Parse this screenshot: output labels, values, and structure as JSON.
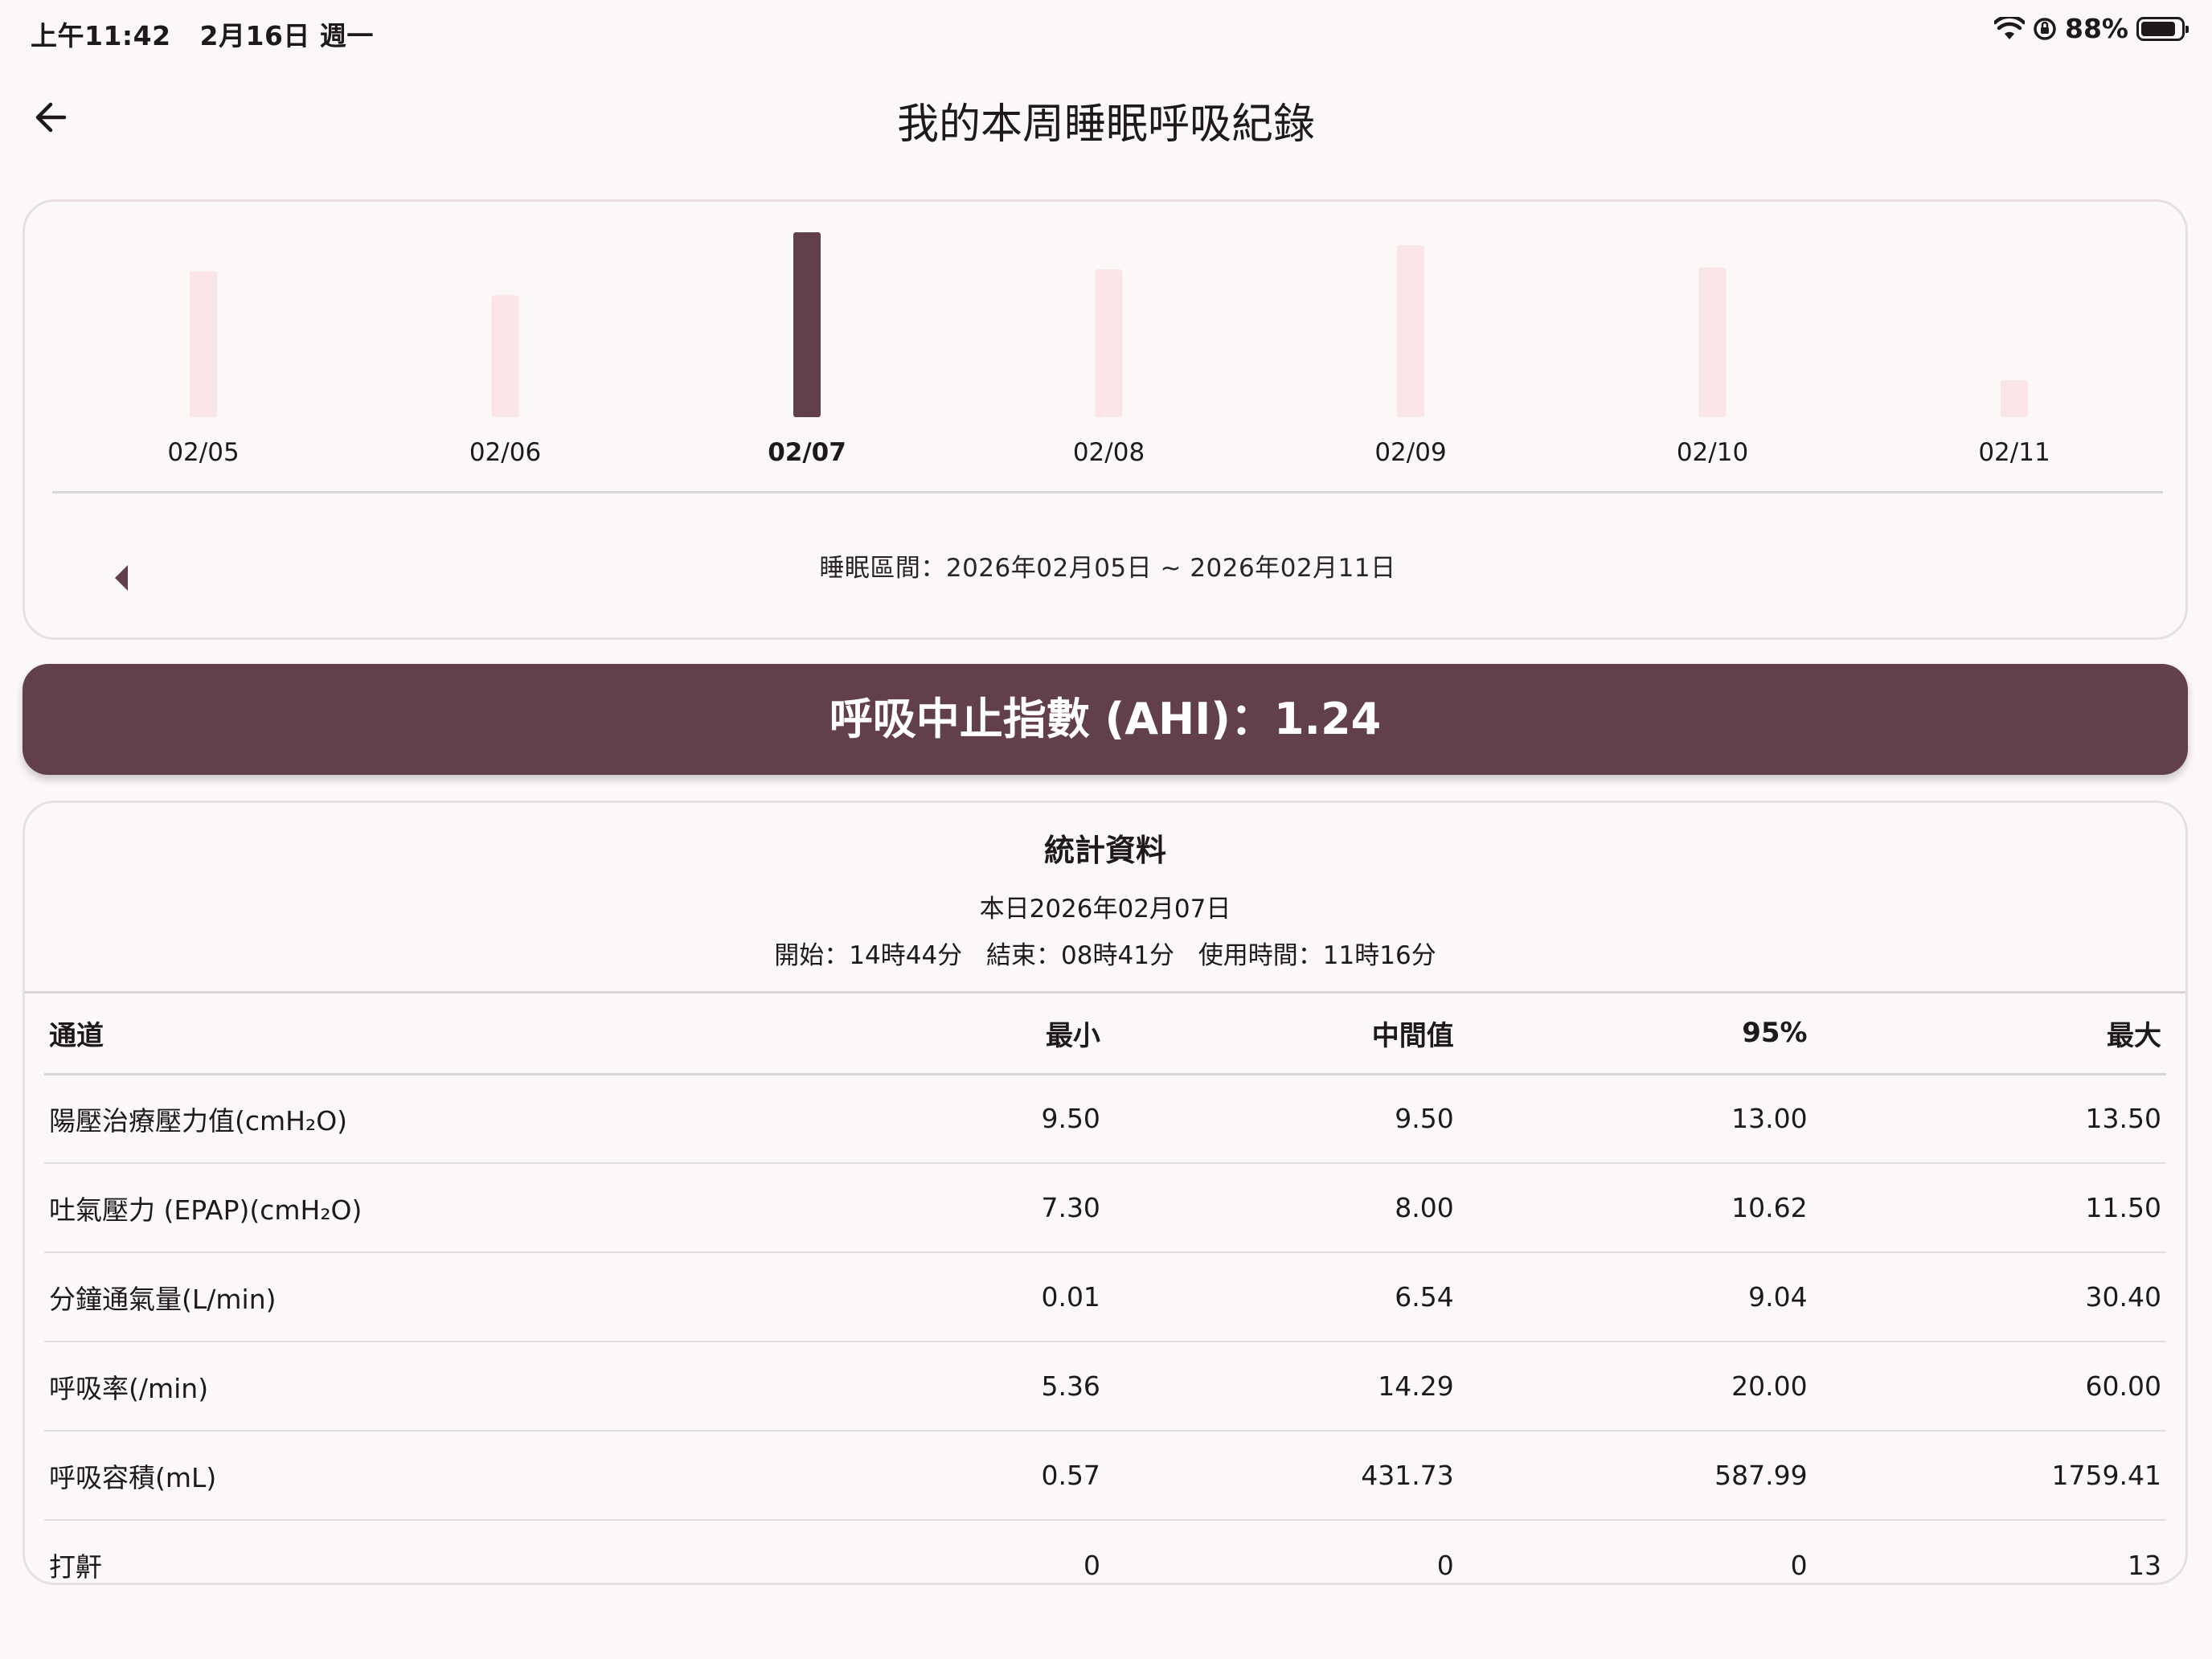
{
  "status_bar": {
    "time": "上午11:42",
    "date": "2月16日 週一",
    "battery": "88%",
    "battery_level": 0.88,
    "icons": [
      "wifi-icon",
      "orientation-lock-icon",
      "battery-icon"
    ]
  },
  "header": {
    "back_icon": "arrow-back-icon",
    "title": "我的本周睡眠呼吸紀錄"
  },
  "chart": {
    "selected_index": 2,
    "colors": {
      "selected": "#623f4d",
      "normal": "#fce5e9"
    },
    "range_label": "睡眠區間：2026年02月05日 ~ 2026年02月11日",
    "prev_icon": "triangle-left-icon"
  },
  "chart_data": {
    "type": "bar",
    "categories": [
      "02/05",
      "02/06",
      "02/07",
      "02/08",
      "02/09",
      "02/10",
      "02/11"
    ],
    "values": [
      0.79,
      0.66,
      1.0,
      0.8,
      0.93,
      0.81,
      0.2
    ],
    "ylim": [
      0,
      1
    ],
    "title": "",
    "xlabel": "",
    "ylabel": "",
    "grid": false
  },
  "ahi": {
    "text": "呼吸中止指數 (AHI)：1.24",
    "bg_color": "#623f4d"
  },
  "stats": {
    "title": "統計資料",
    "date": "本日2026年02月07日",
    "start": "開始：14時44分",
    "end": "結束：08時41分",
    "usage": "使用時間：11時16分",
    "headers": [
      "通道",
      "最小",
      "中間值",
      "95%",
      "最大"
    ],
    "rows": [
      [
        "陽壓治療壓力值(cmH₂O)",
        "9.50",
        "9.50",
        "13.00",
        "13.50"
      ],
      [
        "吐氣壓力 (EPAP)(cmH₂O)",
        "7.30",
        "8.00",
        "10.62",
        "11.50"
      ],
      [
        "分鐘通氣量(L/min)",
        "0.01",
        "6.54",
        "9.04",
        "30.40"
      ],
      [
        "呼吸率(/min)",
        "5.36",
        "14.29",
        "20.00",
        "60.00"
      ],
      [
        "呼吸容積(mL)",
        "0.57",
        "431.73",
        "587.99",
        "1759.41"
      ],
      [
        "打鼾",
        "0",
        "0",
        "0",
        "13"
      ]
    ]
  }
}
